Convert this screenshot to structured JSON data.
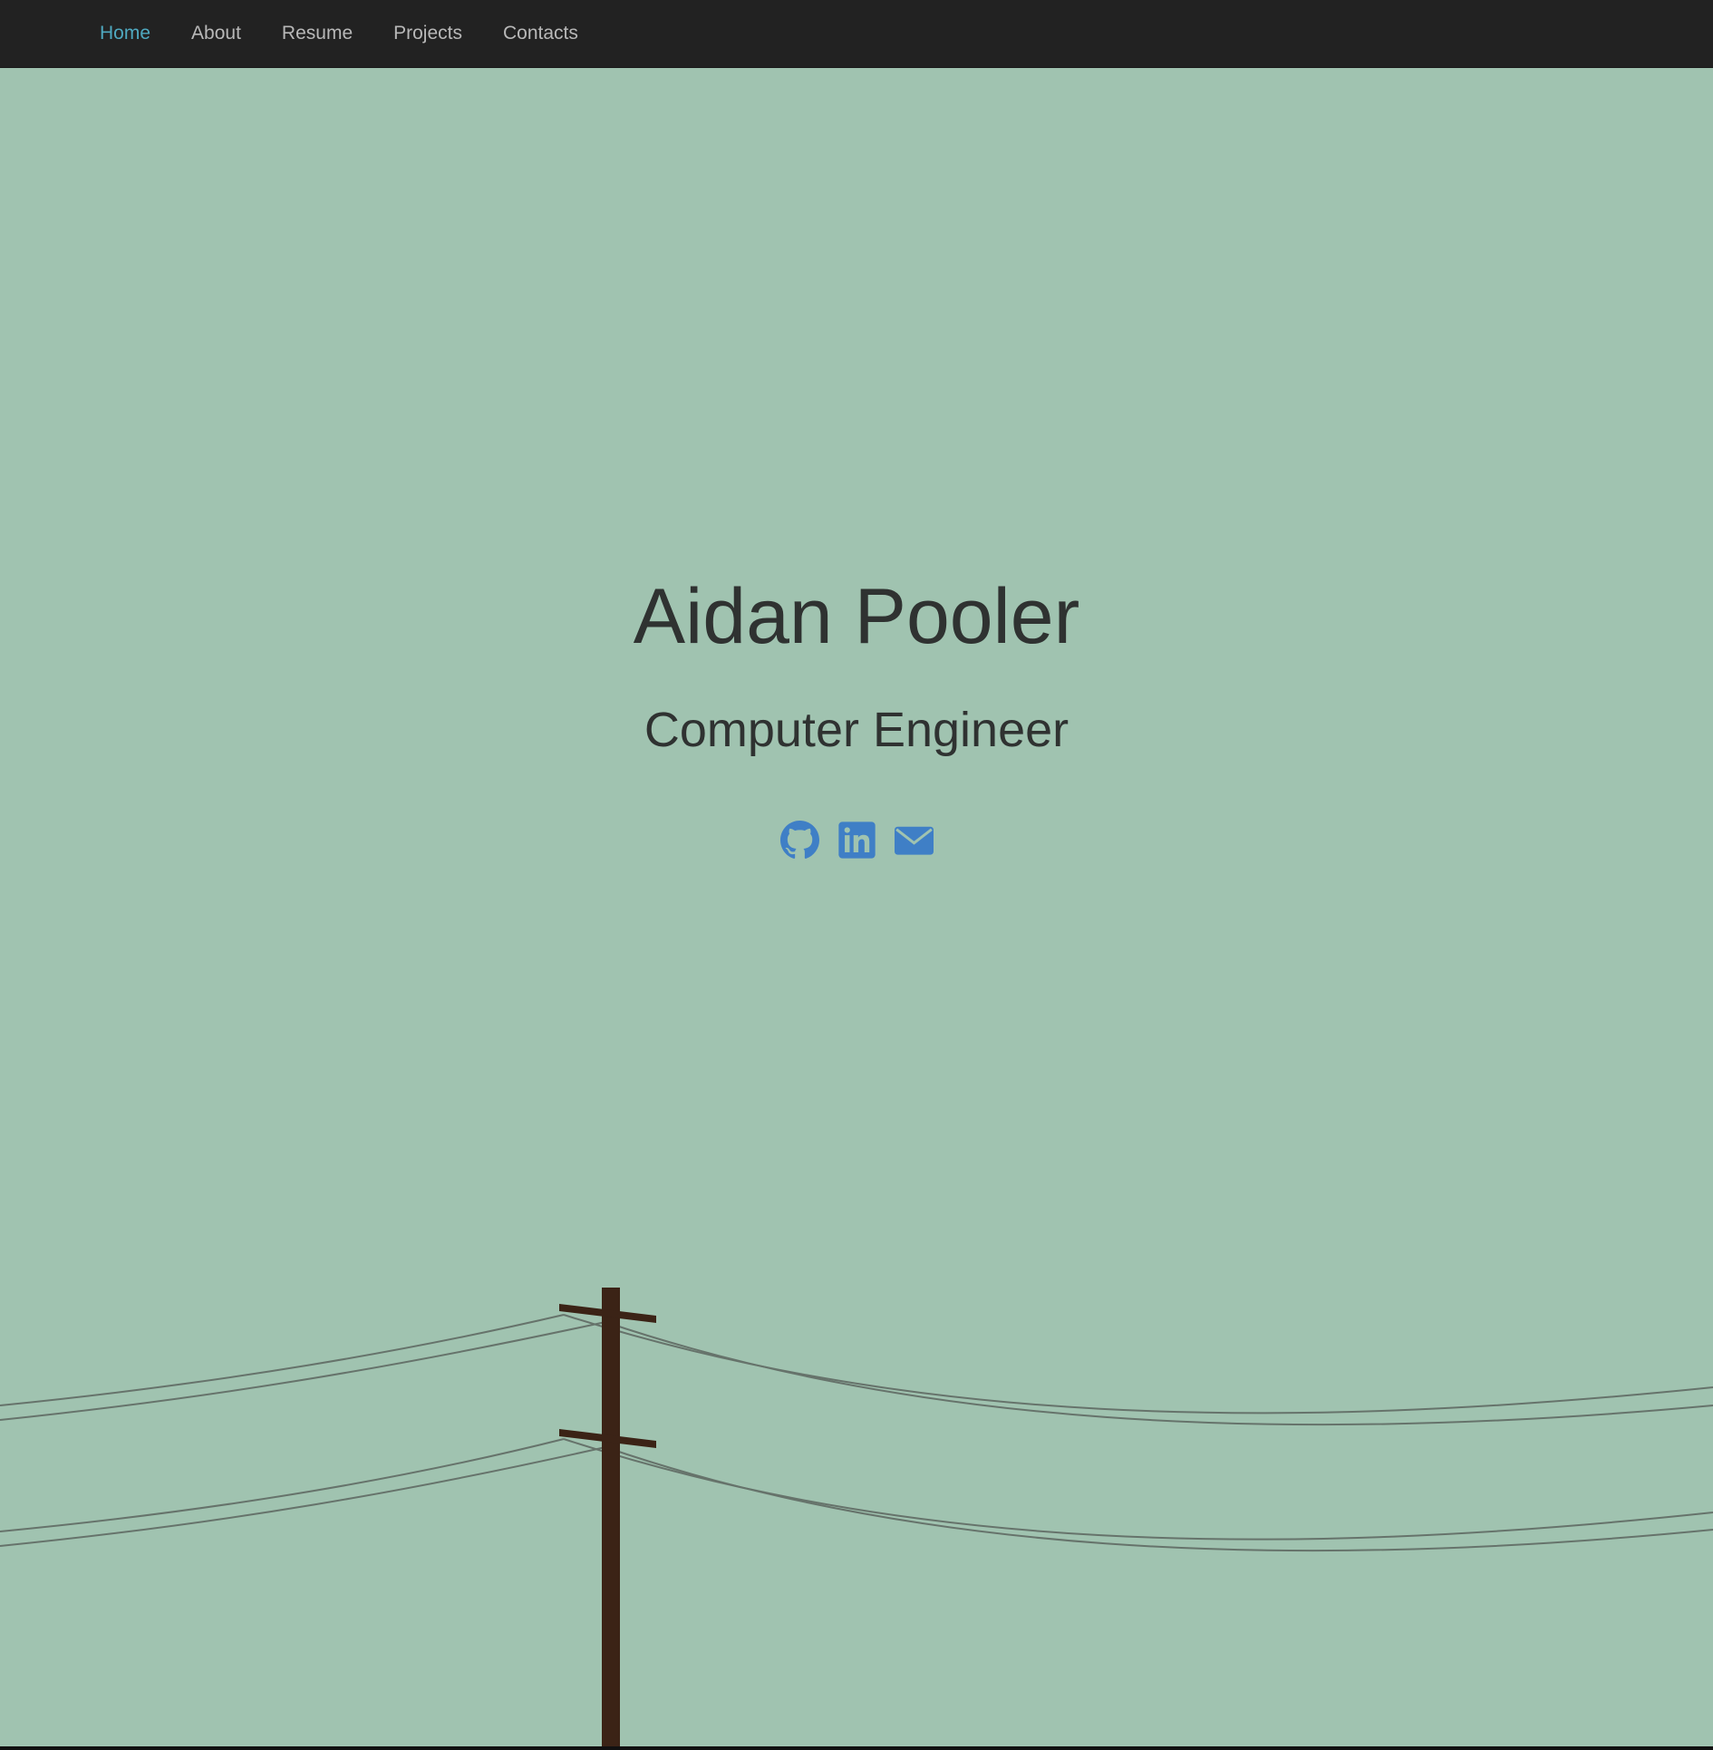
{
  "nav": {
    "items": [
      {
        "label": "Home",
        "active": true
      },
      {
        "label": "About",
        "active": false
      },
      {
        "label": "Resume",
        "active": false
      },
      {
        "label": "Projects",
        "active": false
      },
      {
        "label": "Contacts",
        "active": false
      }
    ]
  },
  "hero": {
    "name": "Aidan Pooler",
    "title": "Computer Engineer"
  },
  "social": {
    "icons": [
      "github-icon",
      "linkedin-icon",
      "envelope-icon"
    ],
    "icon_color": "#3f7fc6"
  },
  "colors": {
    "navbar_bg": "#222222",
    "nav_text": "#b8b8b8",
    "nav_active": "#4fa9c0",
    "hero_bg": "#a0c3b0",
    "heading_text": "#2f3231",
    "pole": "#3b2316",
    "wire": "#66736b"
  }
}
